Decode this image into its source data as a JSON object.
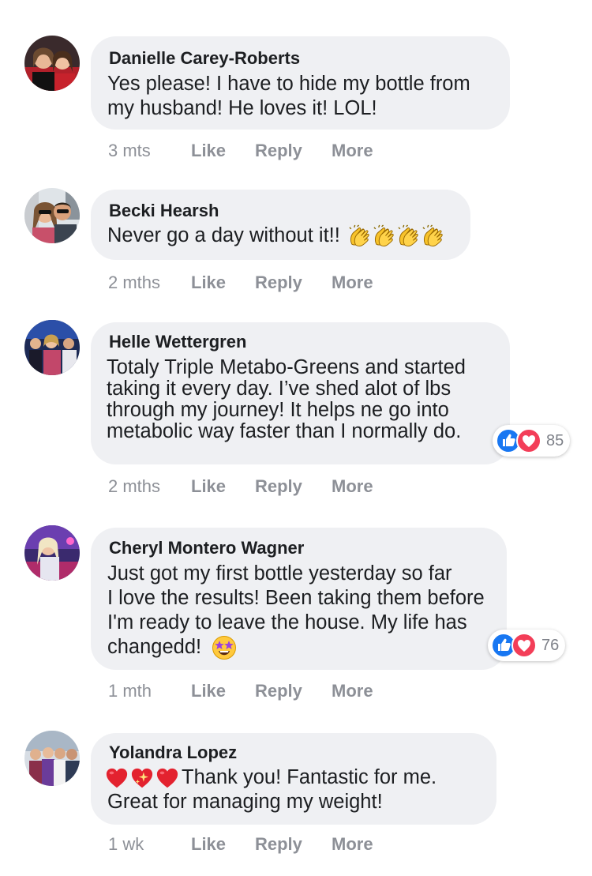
{
  "comments": [
    {
      "name": "Danielle Carey-Roberts",
      "lines": [
        "Yes please! I have to hide my bottle from",
        "my husband! He loves it! LOL!"
      ],
      "time": "3 mts",
      "actions": {
        "like": "Like",
        "reply": "Reply",
        "more": "More"
      }
    },
    {
      "name": "Becki Hearsh",
      "lines": [
        "Never go a day without it!!"
      ],
      "emoji": [
        "clapping-hands",
        "clapping-hands",
        "clapping-hands",
        "clapping-hands"
      ],
      "time": "2 mths",
      "actions": {
        "like": "Like",
        "reply": "Reply",
        "more": "More"
      }
    },
    {
      "name": "Helle Wettergren",
      "lines": [
        "Totaly Triple Metabo-Greens and started",
        "taking it every day. I’ve shed alot of lbs",
        "through my journey! It helps ne go into",
        "metabolic way faster than I normally do."
      ],
      "time": "2 mths",
      "reactions": {
        "icons": [
          "like",
          "love"
        ],
        "count": "85"
      },
      "actions": {
        "like": "Like",
        "reply": "Reply",
        "more": "More"
      }
    },
    {
      "name": "Cheryl Montero Wagner",
      "lines": [
        "Just got my first bottle yesterday so far",
        "I love the results! Been taking them before",
        "I'm ready to leave the house. My life has",
        "changedd!"
      ],
      "emoji": [
        "star-struck"
      ],
      "time": "1 mth",
      "reactions": {
        "icons": [
          "like",
          "love"
        ],
        "count": "76"
      },
      "actions": {
        "like": "Like",
        "reply": "Reply",
        "more": "More"
      }
    },
    {
      "name": "Yolandra Lopez",
      "emoji": [
        "red-heart",
        "sparkling-heart",
        "red-heart"
      ],
      "lines": [
        "Thank you! Fantastic for me.",
        "Great for managing my weight!"
      ],
      "time": "1 wk",
      "actions": {
        "like": "Like",
        "reply": "Reply",
        "more": "More"
      }
    }
  ],
  "colors": {
    "bubble": "#eff0f3",
    "action_text": "#8d9097",
    "like_blue": "#1877f2",
    "love_red": "#f33e58"
  }
}
